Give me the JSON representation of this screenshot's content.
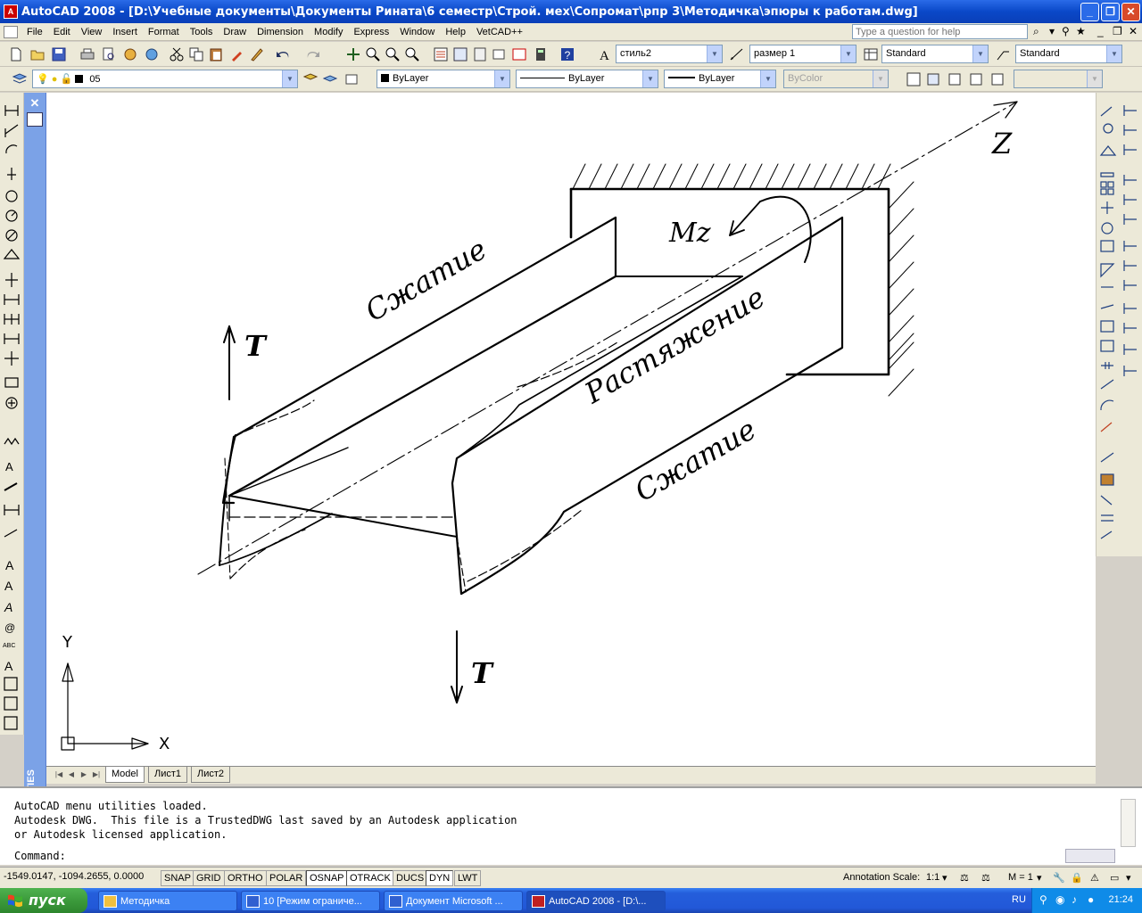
{
  "window": {
    "title": "AutoCAD 2008 - [D:\\Учебные документы\\Документы Рината\\6 семестр\\Строй. мех\\Сопромат\\рпр 3\\Методичка\\эпюры к работам.dwg]",
    "app_icon_label": "A"
  },
  "menu": {
    "items": [
      "File",
      "Edit",
      "View",
      "Insert",
      "Format",
      "Tools",
      "Draw",
      "Dimension",
      "Modify",
      "Express",
      "Window",
      "Help",
      "VetCAD++"
    ],
    "help_placeholder": "Type a question for help"
  },
  "styles_toolbar": {
    "text_style": "стиль2",
    "dim_style": "размер 1",
    "table_style": "Standard",
    "multileader_style": "Standard"
  },
  "layers_toolbar": {
    "layer": "05",
    "color": "ByLayer",
    "linetype": "ByLayer",
    "lineweight": "ByLayer",
    "plot_style": "ByColor"
  },
  "properties_panel": {
    "label": "PROPERTIES"
  },
  "drawing": {
    "label_z": "Z",
    "label_mz": "Mz",
    "label_t_top": "T",
    "label_t_bottom": "T",
    "label_compression_top": "Сжатие",
    "label_tension": "Растяжение",
    "label_compression_bottom": "Сжатие",
    "ucs_y": "Y",
    "ucs_x": "X"
  },
  "layout_tabs": [
    "Model",
    "Лист1",
    "Лист2"
  ],
  "command": {
    "lines": [
      "AutoCAD menu utilities loaded.",
      "Autodesk DWG.  This file is a TrustedDWG last saved by an Autodesk application",
      "or Autodesk licensed application.",
      "Command:"
    ]
  },
  "status": {
    "coordinates": "-1549.0147, -1094.2655, 0.0000",
    "toggles": [
      {
        "label": "SNAP",
        "on": false
      },
      {
        "label": "GRID",
        "on": false
      },
      {
        "label": "ORTHO",
        "on": false
      },
      {
        "label": "POLAR",
        "on": false
      },
      {
        "label": "OSNAP",
        "on": true
      },
      {
        "label": "OTRACK",
        "on": true
      },
      {
        "label": "DUCS",
        "on": false
      },
      {
        "label": "DYN",
        "on": true
      },
      {
        "label": "LWT",
        "on": false
      }
    ],
    "annotation_scale_label": "Annotation Scale:",
    "annotation_scale_value": "1:1",
    "m_value": "M = 1"
  },
  "taskbar": {
    "start_label": "пуск",
    "tasks": [
      "Методичка",
      "10 [Режим ограниче...",
      "Документ Microsoft ...",
      "AutoCAD 2008 - [D:\\..."
    ],
    "language": "RU",
    "clock": "21:24"
  }
}
